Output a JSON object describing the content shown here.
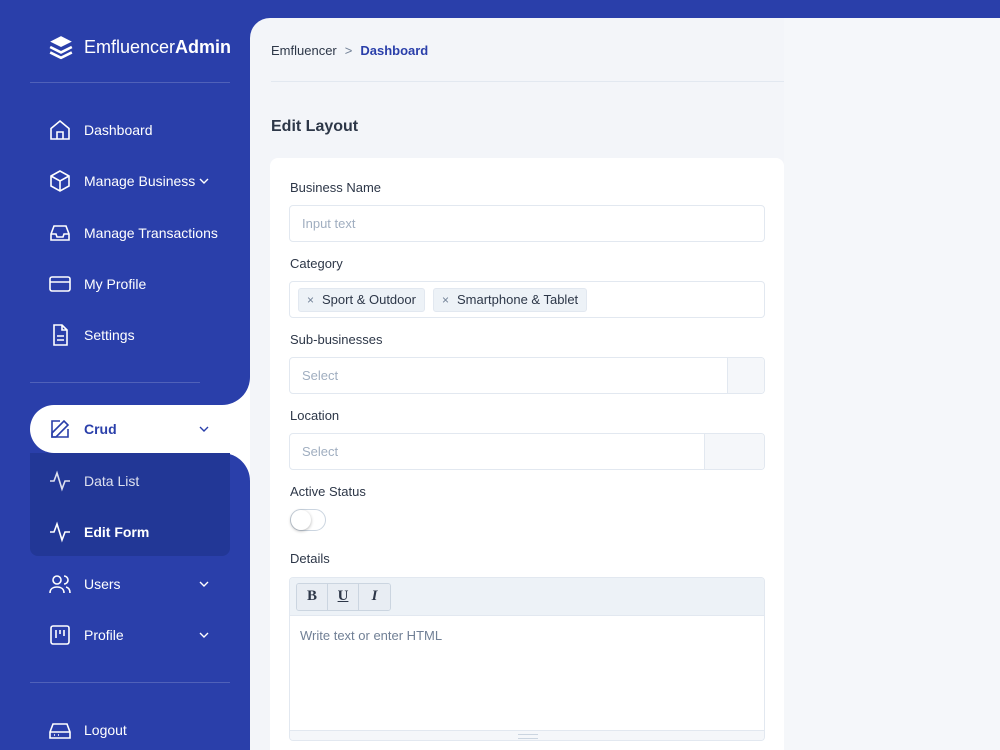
{
  "brand": {
    "name_regular": "Emfluencer",
    "name_bold": "Admin"
  },
  "sidebar": {
    "items": [
      {
        "label": "Dashboard"
      },
      {
        "label": "Manage Business"
      },
      {
        "label": "Manage Transactions"
      },
      {
        "label": "My Profile"
      },
      {
        "label": "Settings"
      },
      {
        "label": "Crud"
      },
      {
        "label": "Data List"
      },
      {
        "label": "Edit Form"
      },
      {
        "label": "Users"
      },
      {
        "label": "Profile"
      },
      {
        "label": "Logout"
      }
    ]
  },
  "breadcrumb": {
    "root": "Emfluencer",
    "separator": ">",
    "current": "Dashboard"
  },
  "page": {
    "title": "Edit Layout"
  },
  "form": {
    "business_name": {
      "label": "Business Name",
      "placeholder": "Input text"
    },
    "category": {
      "label": "Category",
      "tags": [
        "Sport & Outdoor",
        "Smartphone & Tablet"
      ],
      "remove_glyph": "×"
    },
    "sub_businesses": {
      "label": "Sub-businesses",
      "placeholder": "Select"
    },
    "location": {
      "label": "Location",
      "placeholder": "Select"
    },
    "active_status": {
      "label": "Active Status",
      "on": false
    },
    "details": {
      "label": "Details",
      "bold": "B",
      "underline": "U",
      "italic": "I",
      "placeholder": "Write text or enter HTML"
    }
  },
  "colors": {
    "sidebar": "#2a3faa",
    "accent": "#2a3faa",
    "background": "#f3f5f9"
  }
}
